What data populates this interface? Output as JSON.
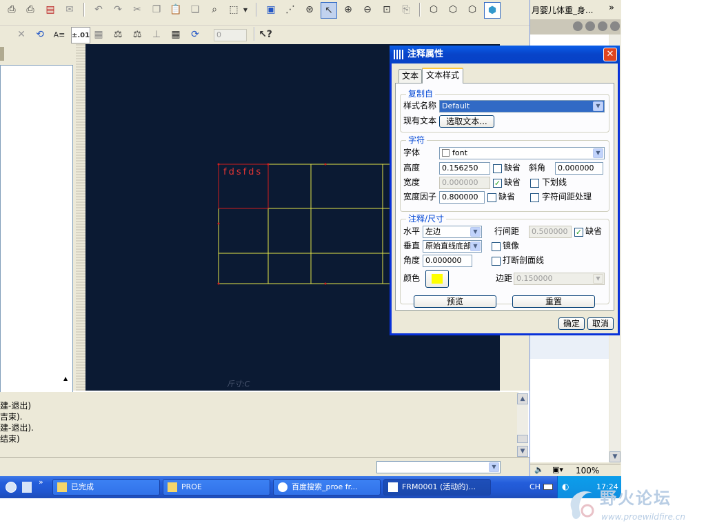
{
  "toolbar": {
    "spin_value": "0",
    "precision_label": "±.01"
  },
  "canvas": {
    "note_text": "fdsfds",
    "watermark": "斤寸:C"
  },
  "messages": [
    "建-退出)",
    "吉束).",
    "建-退出).",
    "结束)"
  ],
  "right_pane": {
    "tab_title": "月婴儿体重_身...",
    "zoom": "100%"
  },
  "taskbar": {
    "items": [
      {
        "label": "已完成"
      },
      {
        "label": "PROE"
      },
      {
        "label": "百度搜索_proe fr..."
      },
      {
        "label": "FRM0001 (活动的)..."
      }
    ],
    "lang": "CH",
    "time": "17:24"
  },
  "forum_watermark": {
    "title": "野火论坛",
    "url": "www.proewildfire.cn"
  },
  "dialog": {
    "title": "注释属性",
    "tabs": [
      "文本",
      "文本样式"
    ],
    "copy_group": {
      "label": "复制自",
      "style_name_label": "样式名称",
      "style_name_value": "Default",
      "existing_text_label": "现有文本",
      "select_text_button": "选取文本..."
    },
    "char_group": {
      "label": "字符",
      "font_label": "字体",
      "font_value": "font",
      "height_label": "高度",
      "height_value": "0.156250",
      "default_label": "缺省",
      "slant_label": "斜角",
      "slant_value": "0.000000",
      "width_label": "宽度",
      "width_value": "0.000000",
      "underline_label": "下划线",
      "width_factor_label": "宽度因子",
      "width_factor_value": "0.800000",
      "kerning_label": "字符间距处理"
    },
    "note_group": {
      "label": "注释/尺寸",
      "horizontal_label": "水平",
      "horizontal_value": "左边",
      "line_spacing_label": "行间距",
      "line_spacing_value": "0.500000",
      "vertical_label": "垂直",
      "vertical_value": "原始直线底部",
      "mirror_label": "镜像",
      "angle_label": "角度",
      "angle_value": "0.000000",
      "break_hatch_label": "打断剖面线",
      "color_label": "颜色",
      "color_value": "#ffff00",
      "margin_label": "边距",
      "margin_value": "0.150000"
    },
    "preview_button": "预览",
    "reset_button": "重置",
    "ok_button": "确定",
    "cancel_button": "取消"
  }
}
